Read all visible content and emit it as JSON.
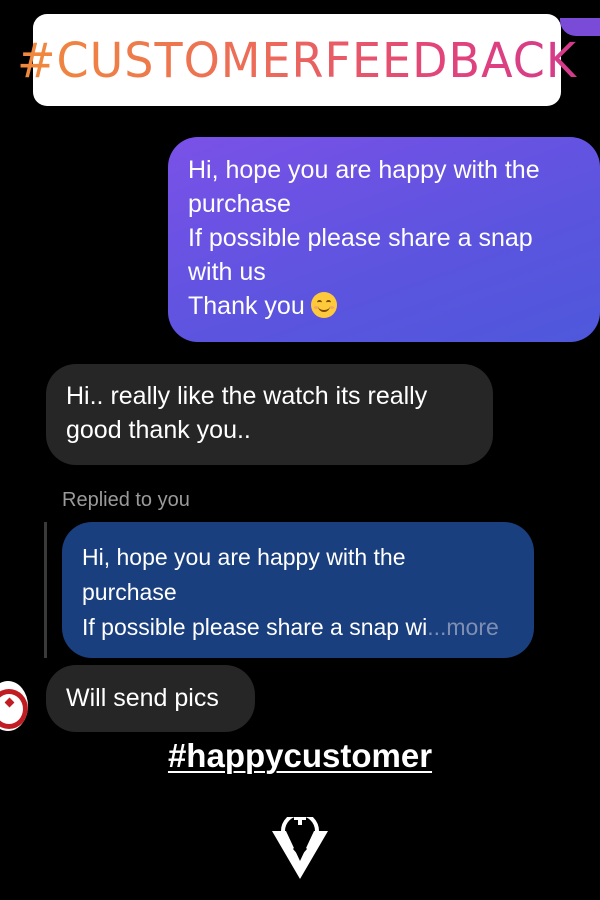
{
  "sticker": {
    "text": "#CUSTOMERFEEDBACK"
  },
  "messages": {
    "outgoing": {
      "lines": [
        "Hi, hope you are happy with the",
        "purchase",
        "If possible please share a snap",
        "with us",
        "Thank you"
      ],
      "emoji": "smiling-face-emoji"
    },
    "incoming": {
      "lines": [
        "Hi.. really like the watch its really",
        "good thank you.."
      ]
    },
    "reply": {
      "label": "Replied to you",
      "quoted_lines": [
        "Hi, hope you are happy with the",
        "purchase",
        "If possible please share a snap wi"
      ],
      "more": "...more"
    },
    "last": {
      "text": "Will send pics"
    }
  },
  "caption": {
    "hashtag": "#happycustomer"
  },
  "colors": {
    "outgoing_bubble": "#6a53e4",
    "incoming_bubble": "#262626",
    "quoted_bubble": "#1a3f7e",
    "background": "#000000"
  },
  "icons": {
    "avatar": "user-avatar",
    "brand_logo": "brand-logo-icon"
  }
}
